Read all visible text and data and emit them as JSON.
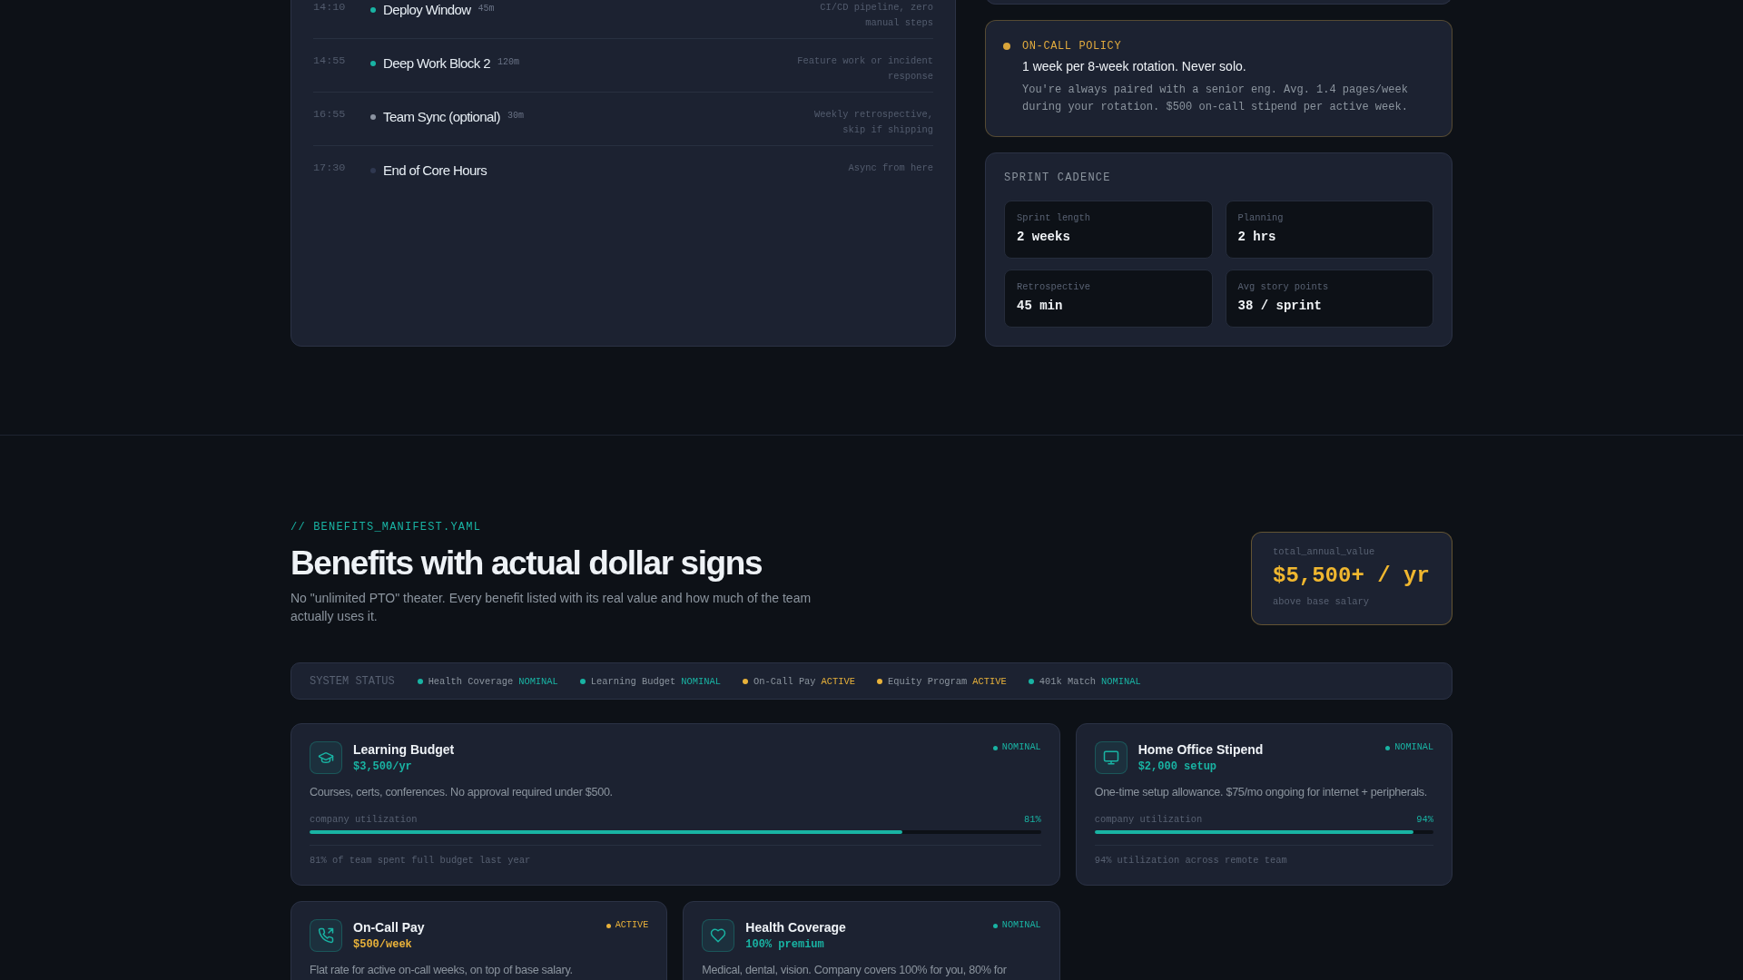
{
  "schedule": {
    "rows": [
      {
        "time": "14:10",
        "title": "Deploy Window",
        "duration": "45m",
        "note": "CI/CD pipeline, zero manual steps",
        "color": "#19b3a3"
      },
      {
        "time": "14:55",
        "title": "Deep Work Block 2",
        "duration": "120m",
        "note": "Feature work or incident response",
        "color": "#19b3a3"
      },
      {
        "time": "16:55",
        "title": "Team Sync (optional)",
        "duration": "30m",
        "note": "Weekly retrospective, skip if shipping",
        "color": "#8b93a1"
      },
      {
        "time": "17:30",
        "title": "End of Core Hours",
        "note": "Async from here",
        "color": "#2f3850"
      }
    ]
  },
  "on_call_policy": {
    "label": "ON-CALL POLICY",
    "headline": "1 week per 8-week rotation. Never solo.",
    "body": "You're always paired with a senior eng. Avg. 1.4 pages/week during your rotation. $500 on-call stipend per active week."
  },
  "sprint_cadence": {
    "title": "SPRINT CADENCE",
    "stats": [
      {
        "label": "Sprint length",
        "value": "2 weeks"
      },
      {
        "label": "Planning",
        "value": "2 hrs"
      },
      {
        "label": "Retrospective",
        "value": "45 min"
      },
      {
        "label": "Avg story points",
        "value": "38 / sprint"
      }
    ]
  },
  "benefits": {
    "eyebrow": "// BENEFITS_MANIFEST.YAML",
    "title": "Benefits with actual dollar signs",
    "subtitle": "No \"unlimited PTO\" theater. Every benefit listed with its real value and how much of the team actually uses it.",
    "total": {
      "label": "total_annual_value",
      "value": "$5,500+ / yr",
      "caption": "above base salary"
    },
    "system_status": {
      "label": "SYSTEM STATUS",
      "items": [
        {
          "name": "Health Coverage",
          "status": "NOMINAL",
          "color": "#19b3a3"
        },
        {
          "name": "Learning Budget",
          "status": "NOMINAL",
          "color": "#19b3a3"
        },
        {
          "name": "On-Call Pay",
          "status": "ACTIVE",
          "color": "#e9b23a"
        },
        {
          "name": "Equity Program",
          "status": "ACTIVE",
          "color": "#e9b23a"
        },
        {
          "name": "401k Match",
          "status": "NOMINAL",
          "color": "#19b3a3"
        }
      ]
    },
    "cards": [
      {
        "kind": "learning",
        "title": "Learning Budget",
        "price": "$3,500/yr",
        "status": "NOMINAL",
        "color": "#19b3a3",
        "description": "Courses, certs, conferences. No approval required under $500.",
        "utilization_label": "company utilization",
        "utilization": "81%",
        "level": 0.81,
        "footnote": "81% of team spent full budget last year"
      },
      {
        "kind": "office",
        "title": "Home Office Stipend",
        "price": "$2,000 setup",
        "status": "NOMINAL",
        "color": "#19b3a3",
        "description": "One-time setup allowance. $75/mo ongoing for internet + peripherals.",
        "utilization_label": "company utilization",
        "utilization": "94%",
        "level": 0.94,
        "footnote": "94% utilization across remote team"
      },
      {
        "kind": "oncall",
        "title": "On-Call Pay",
        "price": "$500/week",
        "status": "ACTIVE",
        "color": "#e9b23a",
        "description": "Flat rate for active on-call weeks, on top of base salary."
      },
      {
        "kind": "health",
        "title": "Health Coverage",
        "price": "100% premium",
        "status": "NOMINAL",
        "color": "#19b3a3",
        "description": "Medical, dental, vision. Company covers 100% for you, 80% for"
      }
    ]
  }
}
